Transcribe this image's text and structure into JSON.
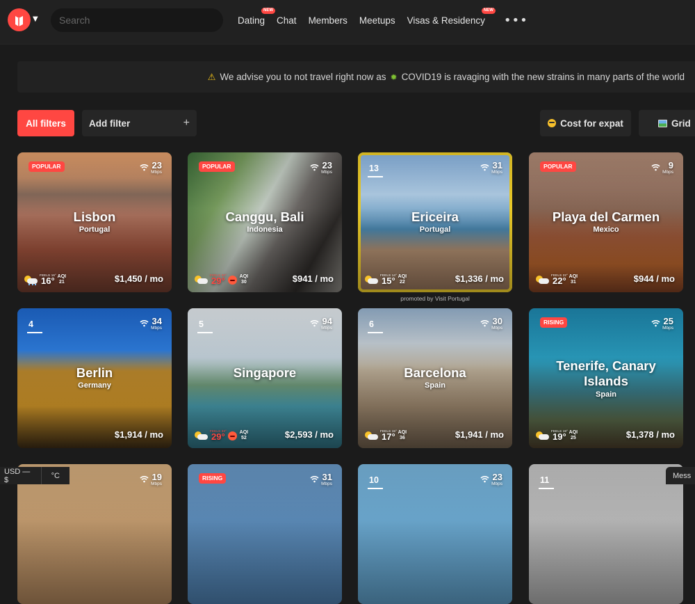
{
  "header": {
    "logo_icon": "nomads-logo-icon",
    "search_placeholder": "Search",
    "nav": [
      {
        "label": "Dating",
        "new": "NEW"
      },
      {
        "label": "Chat",
        "new": ""
      },
      {
        "label": "Members",
        "new": ""
      },
      {
        "label": "Meetups",
        "new": ""
      },
      {
        "label": "Visas & Residency",
        "new": "NEW"
      }
    ],
    "more_icon": "more-dots-icon"
  },
  "banner": {
    "text_before": "We advise you to not travel right now as",
    "text_after": "COVID19 is ravaging with the new strains in many parts of the world",
    "icon_warning": "warning-icon",
    "icon_virus": "virus-icon"
  },
  "filters": {
    "all_filters": "All filters",
    "add_filter": "Add filter",
    "add_icon": "+",
    "sort_label": "Cost for expat",
    "view_label": "Grid"
  },
  "cards": [
    {
      "city": "Lisbon",
      "country": "Portugal",
      "tag": "POPULAR",
      "rank": "",
      "wifi": "23",
      "wifi_unit": "Mbps",
      "feels": "FEELS 16°",
      "temp": "16°",
      "aqi": "21",
      "cost": "$1,450 / mo",
      "hot": false
    },
    {
      "city": "Canggu, Bali",
      "country": "Indonesia",
      "tag": "POPULAR",
      "rank": "",
      "wifi": "23",
      "wifi_unit": "Mbps",
      "feels": "FEELS 33°",
      "temp": "29°",
      "aqi": "30",
      "cost": "$941 / mo",
      "hot": true
    },
    {
      "city": "Ericeira",
      "country": "Portugal",
      "tag": "",
      "rank": "13",
      "wifi": "31",
      "wifi_unit": "Mbps",
      "feels": "FEELS 14°",
      "temp": "15°",
      "aqi": "22",
      "cost": "$1,336 / mo",
      "hot": false
    },
    {
      "city": "Playa del Carmen",
      "country": "Mexico",
      "tag": "POPULAR",
      "rank": "",
      "wifi": "9",
      "wifi_unit": "Mbps",
      "feels": "FEELS 22°",
      "temp": "22°",
      "aqi": "31",
      "cost": "$944 / mo",
      "hot": false
    },
    {
      "city": "Berlin",
      "country": "Germany",
      "tag": "",
      "rank": "4",
      "wifi": "34",
      "wifi_unit": "Mbps",
      "feels": "",
      "temp": "",
      "aqi": "",
      "cost": "$1,914 / mo",
      "hot": false
    },
    {
      "city": "Singapore",
      "country": "",
      "tag": "",
      "rank": "5",
      "wifi": "94",
      "wifi_unit": "Mbps",
      "feels": "FEELS 33°",
      "temp": "29°",
      "aqi": "52",
      "cost": "$2,593 / mo",
      "hot": true
    },
    {
      "city": "Barcelona",
      "country": "Spain",
      "tag": "",
      "rank": "6",
      "wifi": "30",
      "wifi_unit": "Mbps",
      "feels": "FEELS 15°",
      "temp": "17°",
      "aqi": "36",
      "cost": "$1,941 / mo",
      "hot": false
    },
    {
      "city": "Tenerife, Canary Islands",
      "country": "Spain",
      "tag": "RISING",
      "rank": "",
      "wifi": "25",
      "wifi_unit": "Mbps",
      "feels": "FEELS 19°",
      "temp": "19°",
      "aqi": "25",
      "cost": "$1,378 / mo",
      "hot": false
    },
    {
      "city": "",
      "country": "",
      "tag": "",
      "rank": "",
      "wifi": "19",
      "wifi_unit": "Mbps",
      "feels": "",
      "temp": "",
      "aqi": "",
      "cost": "",
      "hot": false
    },
    {
      "city": "",
      "country": "",
      "tag": "RISING",
      "rank": "",
      "wifi": "31",
      "wifi_unit": "Mbps",
      "feels": "",
      "temp": "",
      "aqi": "",
      "cost": "",
      "hot": false
    },
    {
      "city": "",
      "country": "",
      "tag": "",
      "rank": "10",
      "wifi": "23",
      "wifi_unit": "Mbps",
      "feels": "",
      "temp": "",
      "aqi": "",
      "cost": "",
      "hot": false
    },
    {
      "city": "",
      "country": "",
      "tag": "",
      "rank": "11",
      "wifi": "",
      "wifi_unit": "",
      "feels": "",
      "temp": "",
      "aqi": "",
      "cost": "",
      "hot": false
    }
  ],
  "promo": "promoted by Visit Portugal",
  "footer": {
    "currency": "USD — $",
    "unit": "°C",
    "messages": "Mess"
  },
  "colors": {
    "accent": "#ff4742",
    "highlight": "#f5d32a",
    "bg": "#1b1b1b"
  }
}
